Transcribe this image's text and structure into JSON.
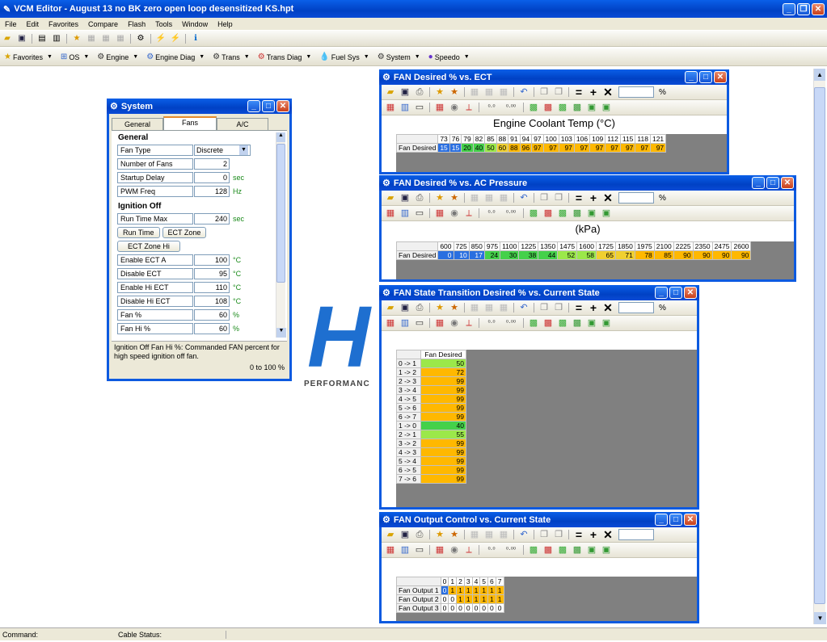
{
  "app": {
    "title": "VCM Editor - August 13 no BK zero open loop desensitized KS.hpt"
  },
  "menu": [
    "File",
    "Edit",
    "Favorites",
    "Compare",
    "Flash",
    "Tools",
    "Window",
    "Help"
  ],
  "nav": [
    "Favorites",
    "OS",
    "Engine",
    "Engine Diag",
    "Trans",
    "Trans Diag",
    "Fuel Sys",
    "System",
    "Speedo"
  ],
  "logo": {
    "text": "H",
    "sub": "PERFORMANC"
  },
  "system": {
    "title": "System",
    "tabs": [
      "General",
      "Fans",
      "A/C"
    ],
    "section_general": "General",
    "fan_type_label": "Fan Type",
    "fan_type_value": "Discrete",
    "rows1": [
      {
        "label": "Number of Fans",
        "value": "2",
        "unit": ""
      },
      {
        "label": "Startup Delay",
        "value": "0",
        "unit": "sec"
      },
      {
        "label": "PWM Freq",
        "value": "128",
        "unit": "Hz"
      }
    ],
    "section_ign": "Ignition Off",
    "run_time_max": {
      "label": "Run Time Max",
      "value": "240",
      "unit": "sec"
    },
    "buttons": [
      "Run Time",
      "ECT Zone"
    ],
    "button_hi": "ECT Zone Hi",
    "rows2": [
      {
        "label": "Enable ECT A",
        "value": "100",
        "unit": "°C"
      },
      {
        "label": "Disable ECT",
        "value": "95",
        "unit": "°C"
      },
      {
        "label": "Enable Hi ECT",
        "value": "110",
        "unit": "°C"
      },
      {
        "label": "Disable Hi ECT",
        "value": "108",
        "unit": "°C"
      },
      {
        "label": "Fan %",
        "value": "60",
        "unit": "%"
      },
      {
        "label": "Fan Hi %",
        "value": "60",
        "unit": "%"
      }
    ],
    "desc": "Ignition Off Fan Hi %: Commanded FAN percent for high speed ignition off fan.",
    "range": "0 to 100 %"
  },
  "ect": {
    "title": "FAN Desired % vs. ECT",
    "unit": "%",
    "axis": "Engine Coolant Temp (°C)",
    "rowlabel": "Fan Desired",
    "cols": [
      "73",
      "76",
      "79",
      "82",
      "85",
      "88",
      "91",
      "94",
      "97",
      "100",
      "103",
      "106",
      "109",
      "112",
      "115",
      "118",
      "121"
    ],
    "vals": [
      "15",
      "15",
      "20",
      "40",
      "50",
      "60",
      "88",
      "96",
      "97",
      "97",
      "97",
      "97",
      "97",
      "97",
      "97",
      "97",
      "97"
    ]
  },
  "ac": {
    "title": "FAN Desired % vs. AC Pressure",
    "unit": "%",
    "axis": "(kPa)",
    "rowlabel": "Fan Desired",
    "cols": [
      "600",
      "725",
      "850",
      "975",
      "1100",
      "1225",
      "1350",
      "1475",
      "1600",
      "1725",
      "1850",
      "1975",
      "2100",
      "2225",
      "2350",
      "2475",
      "2600"
    ],
    "vals": [
      "0",
      "10",
      "17",
      "24",
      "30",
      "38",
      "44",
      "52",
      "58",
      "65",
      "71",
      "78",
      "85",
      "90",
      "90",
      "90",
      "90"
    ]
  },
  "state": {
    "title": "FAN State Transition Desired % vs. Current State",
    "unit": "%",
    "colhead": "Fan Desired",
    "rows": [
      {
        "l": "0 -> 1",
        "v": "50"
      },
      {
        "l": "1 -> 2",
        "v": "72"
      },
      {
        "l": "2 -> 3",
        "v": "99"
      },
      {
        "l": "3 -> 4",
        "v": "99"
      },
      {
        "l": "4 -> 5",
        "v": "99"
      },
      {
        "l": "5 -> 6",
        "v": "99"
      },
      {
        "l": "6 -> 7",
        "v": "99"
      },
      {
        "l": "1 -> 0",
        "v": "40"
      },
      {
        "l": "2 -> 1",
        "v": "55"
      },
      {
        "l": "3 -> 2",
        "v": "99"
      },
      {
        "l": "4 -> 3",
        "v": "99"
      },
      {
        "l": "5 -> 4",
        "v": "99"
      },
      {
        "l": "6 -> 5",
        "v": "99"
      },
      {
        "l": "7 -> 6",
        "v": "99"
      }
    ]
  },
  "output": {
    "title": "FAN Output Control vs. Current State",
    "cols": [
      "0",
      "1",
      "2",
      "3",
      "4",
      "5",
      "6",
      "7"
    ],
    "rows": [
      {
        "l": "Fan Output 1",
        "v": [
          "0",
          "1",
          "1",
          "1",
          "1",
          "1",
          "1",
          "1"
        ]
      },
      {
        "l": "Fan Output 2",
        "v": [
          "0",
          "0",
          "1",
          "1",
          "1",
          "1",
          "1",
          "1"
        ]
      },
      {
        "l": "Fan Output 3",
        "v": [
          "0",
          "0",
          "0",
          "0",
          "0",
          "0",
          "0",
          "0"
        ]
      }
    ]
  },
  "status": {
    "command": "Command:",
    "cable": "Cable Status:"
  }
}
